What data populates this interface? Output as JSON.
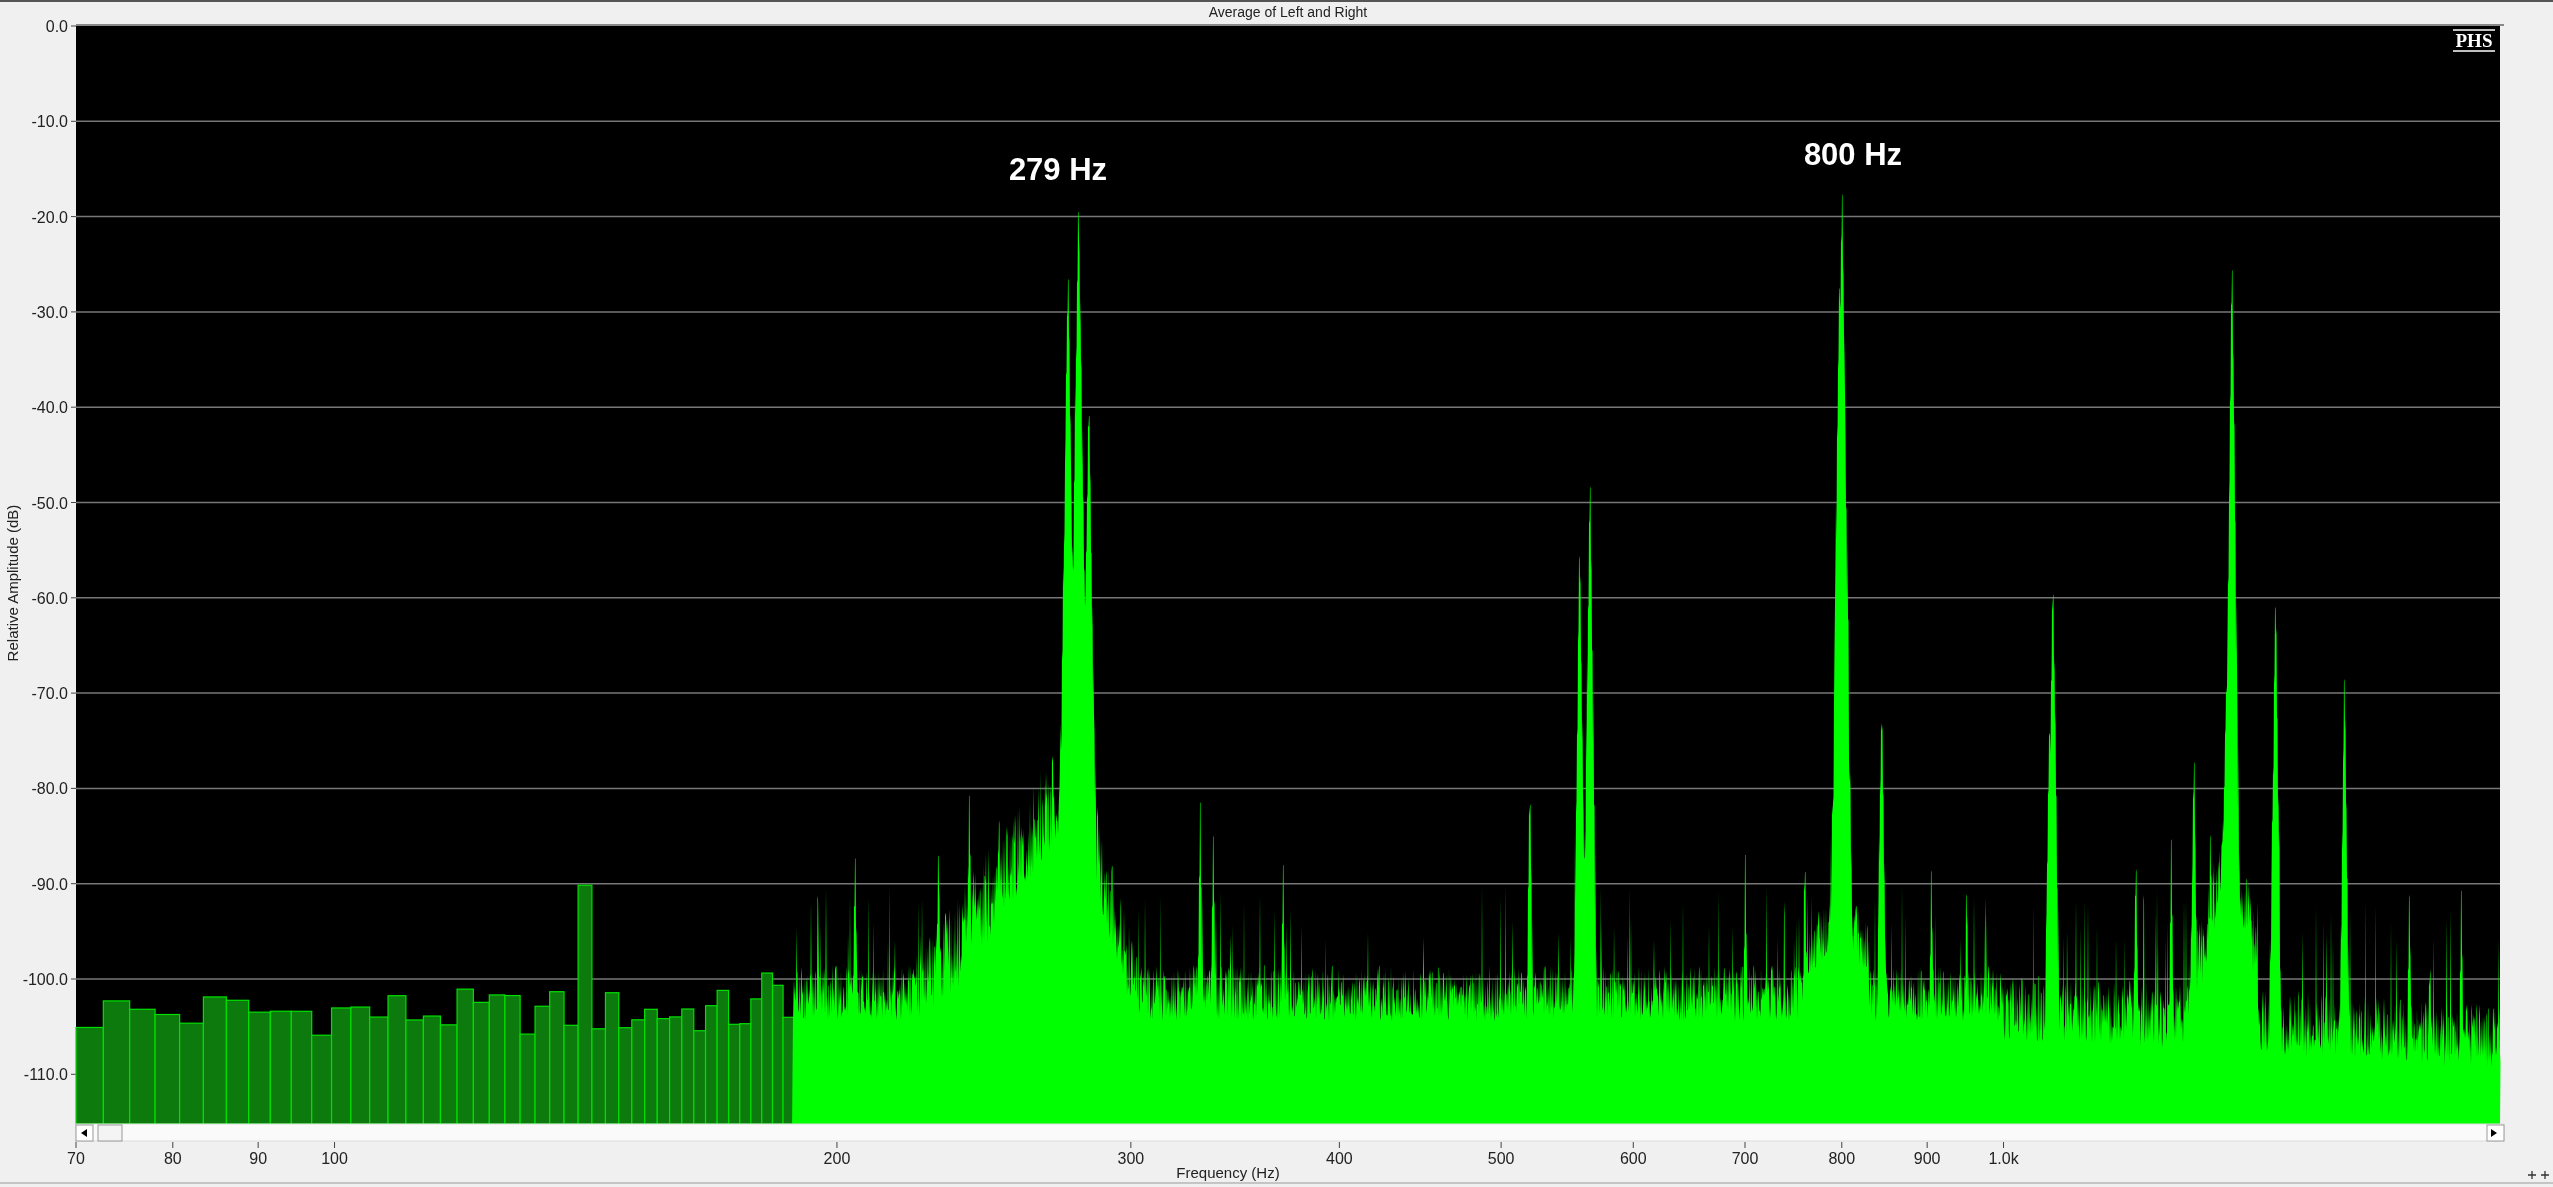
{
  "window": {
    "title": "Average of Left and Right"
  },
  "logo": "PHS",
  "annotations": [
    "279 Hz",
    "800 Hz"
  ],
  "y_axis": {
    "label": "Relative Amplitude (dB)",
    "ticks": [
      "0.0",
      "-10.0",
      "-20.0",
      "-30.0",
      "-40.0",
      "-50.0",
      "-60.0",
      "-70.0",
      "-80.0",
      "-90.0",
      "-100.0",
      "-110.0"
    ]
  },
  "x_axis": {
    "label": "Frequency (Hz)",
    "ticks": [
      "70",
      "80",
      "90",
      "100",
      "200",
      "300",
      "400",
      "500",
      "600",
      "700",
      "800",
      "900",
      "1.0k"
    ]
  }
}
